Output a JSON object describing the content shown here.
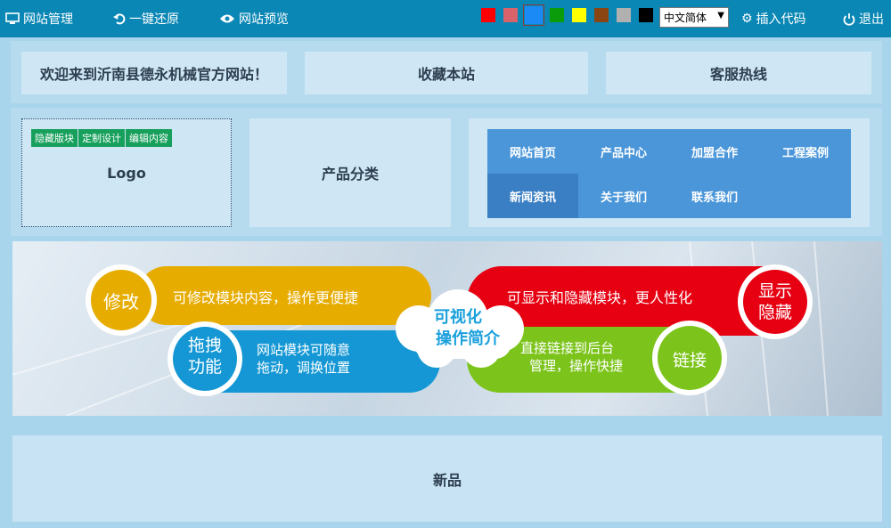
{
  "toolbar": {
    "site_manage": "网站管理",
    "restore": "一键还原",
    "preview": "网站预览",
    "swatches": [
      "#ff0000",
      "#d9626b",
      "#1b8af5",
      "#0a9c0a",
      "#ffff00",
      "#8b4513",
      "#b0b0b0",
      "#000000"
    ],
    "selected_swatch": 2,
    "language": "中文简体",
    "insert_code": "插入代码",
    "logout": "退出"
  },
  "header": {
    "welcome": "欢迎来到沂南县德永机械官方网站！",
    "favorite": "收藏本站",
    "hotline": "客服热线"
  },
  "logo_block": {
    "tools": [
      "隐藏版块",
      "定制设计",
      "编辑内容"
    ],
    "label": "Logo"
  },
  "category": {
    "label": "产品分类"
  },
  "nav": {
    "items": [
      "网站首页",
      "产品中心",
      "加盟合作",
      "工程案例",
      "新闻资讯",
      "关于我们",
      "联系我们"
    ],
    "active_index": 4
  },
  "banner": {
    "center_line1": "可视化",
    "center_line2": "操作简介",
    "modify_badge": "修改",
    "modify_text": "可修改模块内容，操作更便捷",
    "drag_badge_line1": "拖拽",
    "drag_badge_line2": "功能",
    "drag_text_line1": "网站模块可随意",
    "drag_text_line2": "拖动，调换位置",
    "show_text": "可显示和隐藏模块，更人性化",
    "show_badge_line1": "显示",
    "show_badge_line2": "隐藏",
    "link_text_line1": "直接链接到后台",
    "link_text_line2": "管理，操作快捷",
    "link_badge": "链接",
    "colors": {
      "modify": "#e6ac00",
      "drag": "#1497d4",
      "show": "#e60012",
      "link": "#7cc41c",
      "cloud_text": "#1aa0dc"
    }
  },
  "new_products": {
    "label": "新品"
  }
}
